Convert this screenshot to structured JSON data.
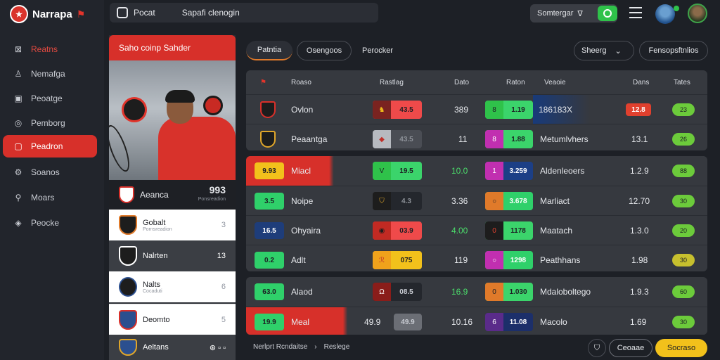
{
  "app": {
    "logo_text": "Narrapa"
  },
  "sidebar": {
    "items": [
      {
        "label": "Reatns",
        "icon": "grid-icon"
      },
      {
        "label": "Nemafga",
        "icon": "person-icon"
      },
      {
        "label": "Peoatge",
        "icon": "box-icon"
      },
      {
        "label": "Pemborg",
        "icon": "location-icon"
      },
      {
        "label": "Peadron",
        "icon": "flag-icon"
      },
      {
        "label": "Soanos",
        "icon": "gear-icon"
      },
      {
        "label": "Moars",
        "icon": "search-icon"
      },
      {
        "label": "Peocke",
        "icon": "cube-icon"
      }
    ]
  },
  "topbar": {
    "tab_label": "Pocat",
    "search_text": "Sapafi clenogin",
    "sort_label": "Somtergar"
  },
  "featured": {
    "header": "Saho  coinp Sahder",
    "team": "Aeanca",
    "score": "993",
    "score_sub": "Ponsreadion",
    "list": [
      {
        "name": "Gobalt",
        "sub": "Pornsreadion",
        "num": "3"
      },
      {
        "name": "Nalrten",
        "sub": "",
        "num": "13"
      },
      {
        "name": "Nalts",
        "sub": "Cocaduti",
        "num": "6"
      },
      {
        "name": "Deomto",
        "sub": "",
        "num": "5"
      },
      {
        "name": "Aeltans",
        "sub": "",
        "num": ""
      }
    ]
  },
  "tabs": [
    {
      "label": "Patntia"
    },
    {
      "label": "Osengoos"
    },
    {
      "label": "Perocker"
    }
  ],
  "filters": {
    "sort": "Sheerg",
    "right": "Fensopsftnlios"
  },
  "table": {
    "headers": [
      "Roaso",
      "Rastlag",
      "Dato",
      "Raton",
      "Veaoie",
      "Dans",
      "Tates"
    ],
    "groups": [
      {
        "rows": [
          {
            "lead": "",
            "team": "Ovlon",
            "odd": "43.5",
            "dato": "389",
            "raton": "1.19",
            "name": "186183X",
            "dans": "12.8",
            "tag": "23"
          },
          {
            "lead": "",
            "team": "Peaantga",
            "odd": "43.5",
            "dato": "11",
            "raton": "1.88",
            "name": "Metumlvhers",
            "dans": "13.1",
            "tag": "26"
          }
        ]
      },
      {
        "rows": [
          {
            "lead": "9.93",
            "team": "Miacl",
            "odd": "19.5",
            "dato": "10.0",
            "raton": "3.259",
            "name": "Aldenleoers",
            "dans": "1.2.9",
            "tag": "88"
          },
          {
            "lead": "3.5",
            "team": "Noipe",
            "odd": "4.3",
            "dato": "3.36",
            "raton": "3.678",
            "name": "Marliact",
            "dans": "12.70",
            "tag": "30"
          },
          {
            "lead": "16.5",
            "team": "Ohyaira",
            "odd": "03.9",
            "dato": "4.00",
            "raton": "1178",
            "name": "Maatach",
            "dans": "1.3.0",
            "tag": "20"
          },
          {
            "lead": "0.2",
            "team": "Adlt",
            "odd": "075",
            "dato": "119",
            "raton": "1298",
            "name": "Peathhans",
            "dans": "1.98",
            "tag": "30"
          }
        ]
      },
      {
        "rows": [
          {
            "lead": "63.0",
            "team": "Alaod",
            "odd": "08.5",
            "dato": "16.9",
            "raton": "1.030",
            "name": "Mdaloboltego",
            "dans": "1.9.3",
            "tag": "60"
          },
          {
            "lead": "19.9",
            "team": "Meal",
            "odd": "49.9",
            "dato": "10.16",
            "raton": "11.08",
            "name": "Macolo",
            "dans": "1.69",
            "tag": "30"
          }
        ]
      }
    ]
  },
  "footer": {
    "left": "Nerlprt Rcndaitse",
    "right": "Reslege",
    "btn1": "Ceoaae",
    "btn2": "Socraso"
  },
  "colors": {
    "accent": "#d7302a",
    "green": "#2fc24a",
    "yellow": "#f2c11b"
  }
}
